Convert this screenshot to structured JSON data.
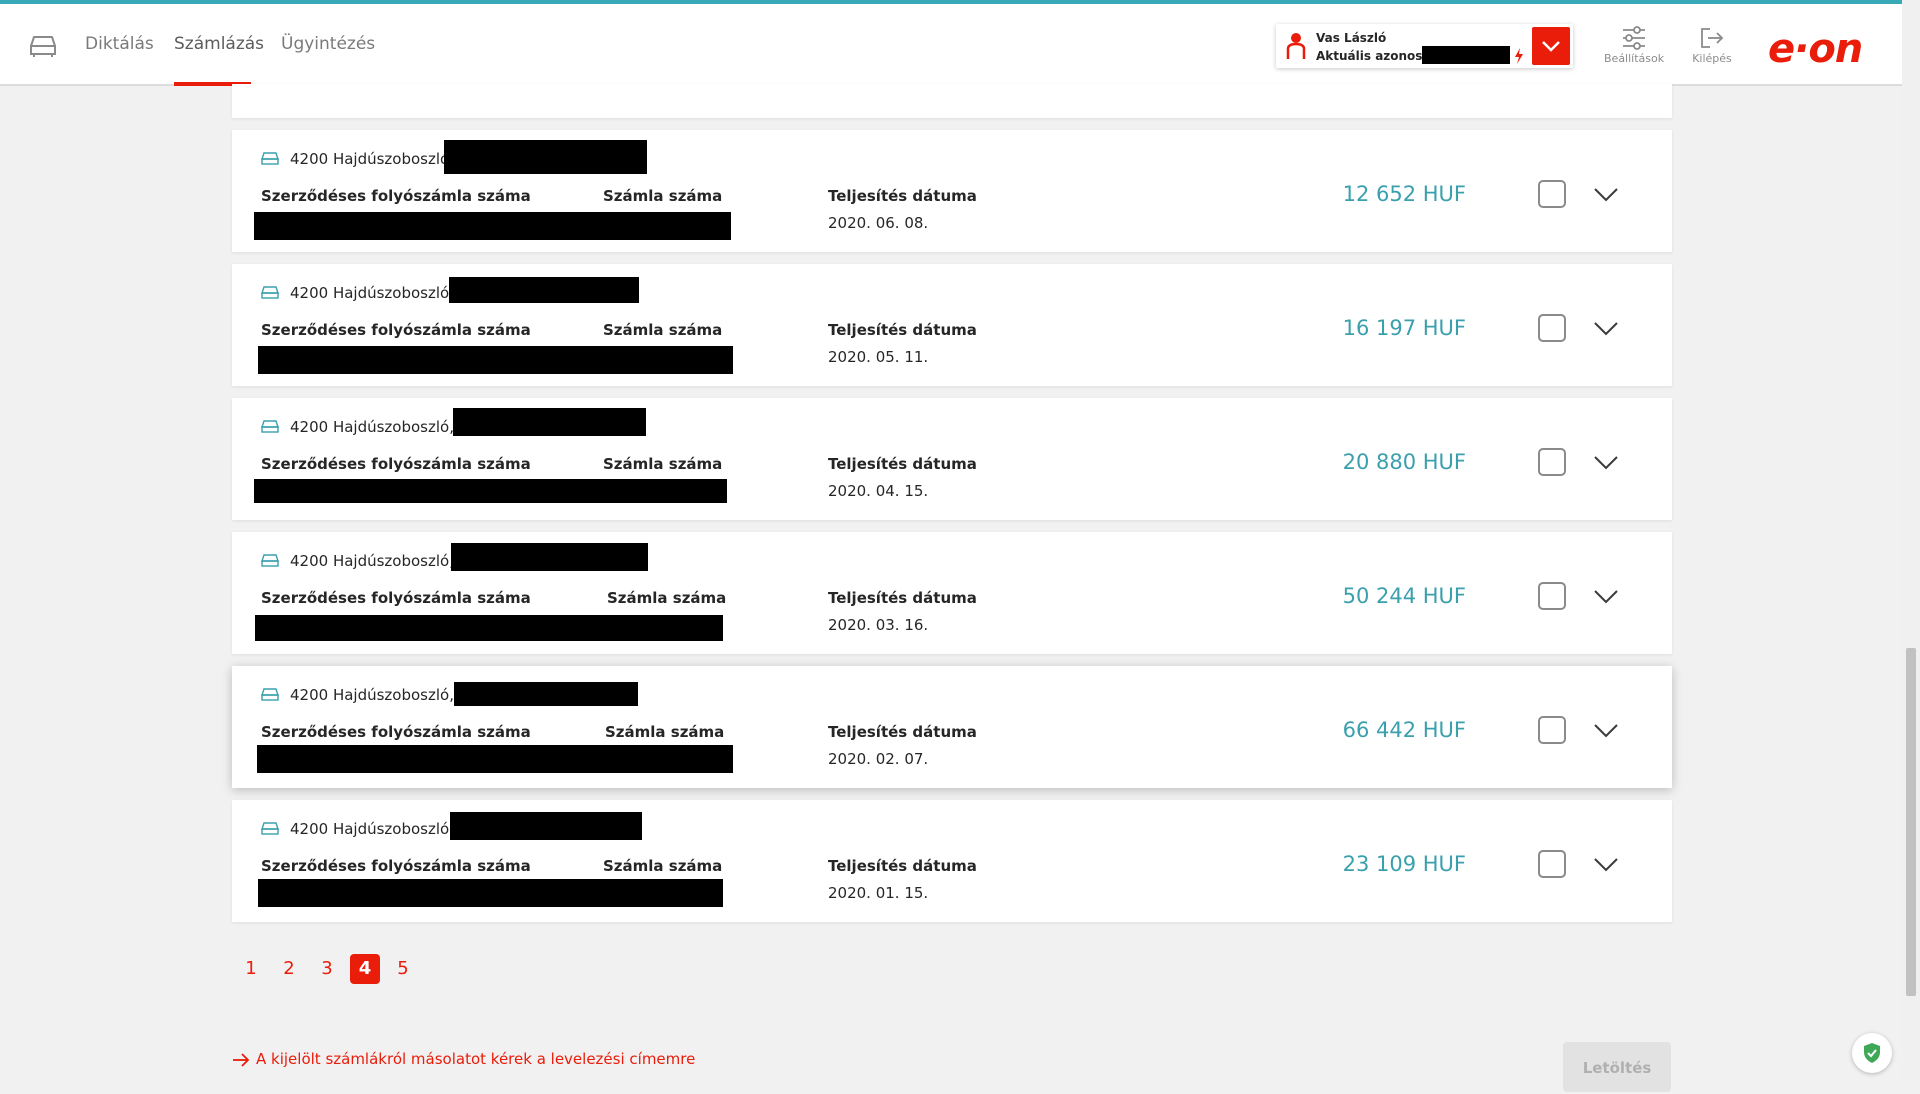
{
  "nav": {
    "items": [
      {
        "label": "Diktálás"
      },
      {
        "label": "Számlázás",
        "active": true
      },
      {
        "label": "Ügyintézés"
      }
    ]
  },
  "user": {
    "name": "Vas László",
    "id_label": "Aktuális azonosító",
    "id_value": "redacted"
  },
  "header_buttons": {
    "settings": "Beállítások",
    "logout": "Kilépés"
  },
  "brand": {
    "logo": "e·on",
    "accent": "#ea1c0a",
    "amount_color": "#3aa0ad"
  },
  "invoices": [
    {
      "address": "4200 Hajdúszoboszló",
      "contract_label": "Szerződéses folyószámla száma",
      "invoice_label": "Számla száma",
      "date_label": "Teljesítés dátuma",
      "date": "2020. 06. 08.",
      "amount": "12 652 HUF"
    },
    {
      "address": "4200 Hajdúszoboszló",
      "contract_label": "Szerződéses folyószámla száma",
      "invoice_label": "Számla száma",
      "date_label": "Teljesítés dátuma",
      "date": "2020. 05. 11.",
      "amount": "16 197 HUF"
    },
    {
      "address": "4200 Hajdúszoboszló,",
      "contract_label": "Szerződéses folyószámla száma",
      "invoice_label": "Számla száma",
      "date_label": "Teljesítés dátuma",
      "date": "2020. 04. 15.",
      "amount": "20 880 HUF"
    },
    {
      "address": "4200 Hajdúszoboszló,",
      "contract_label": "Szerződéses folyószámla száma",
      "invoice_label": "Számla száma",
      "date_label": "Teljesítés dátuma",
      "date": "2020. 03. 16.",
      "amount": "50 244 HUF"
    },
    {
      "address": "4200 Hajdúszoboszló,",
      "contract_label": "Szerződéses folyószámla száma",
      "invoice_label": "Számla száma",
      "date_label": "Teljesítés dátuma",
      "date": "2020. 02. 07.",
      "amount": "66 442 HUF"
    },
    {
      "address": "4200 Hajdúszoboszló,",
      "contract_label": "Szerződéses folyószámla száma",
      "invoice_label": "Számla száma",
      "date_label": "Teljesítés dátuma",
      "date": "2020. 01. 15.",
      "amount": "23 109 HUF"
    }
  ],
  "pagination": {
    "pages": [
      "1",
      "2",
      "3",
      "4",
      "5"
    ],
    "current": "4"
  },
  "footer": {
    "copy_request": "A kijelölt számlákról másolatot kérek a levelezési címemre",
    "download": "Letöltés"
  }
}
